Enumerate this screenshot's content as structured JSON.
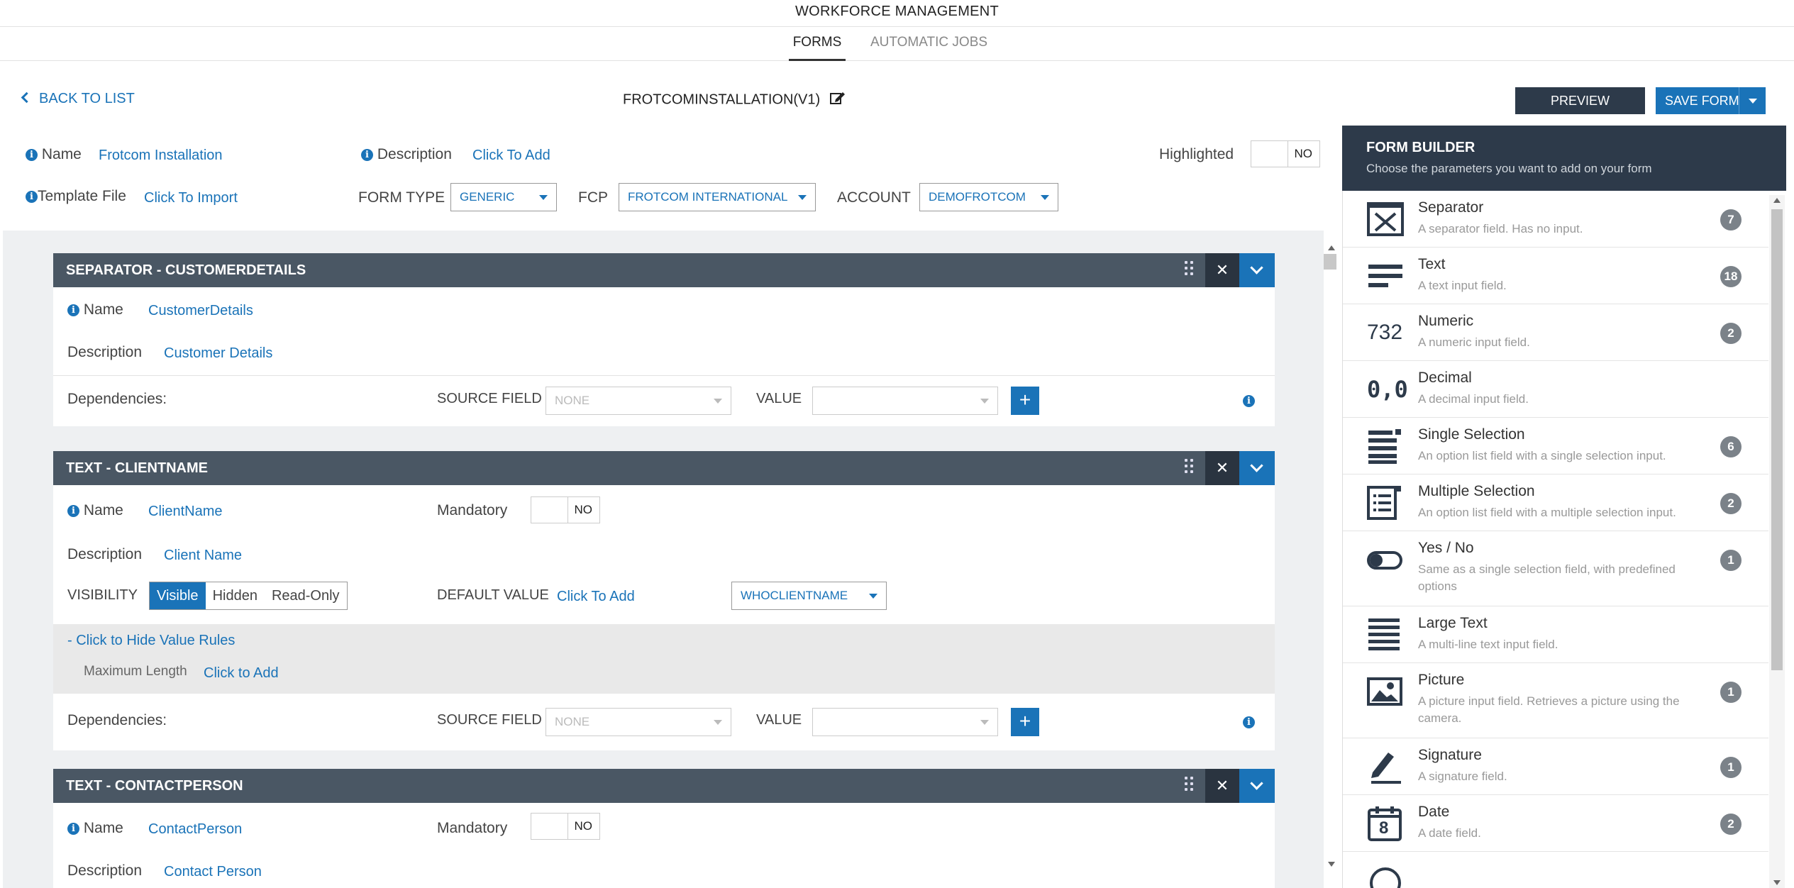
{
  "app": {
    "title": "WORKFORCE MANAGEMENT"
  },
  "tabs": [
    {
      "label": "FORMS"
    },
    {
      "label": "AUTOMATIC JOBS"
    }
  ],
  "header": {
    "back_label": "BACK TO LIST",
    "form_title": "FROTCOMINSTALLATION(V1)",
    "preview_label": "PREVIEW",
    "save_label": "SAVE FORM"
  },
  "props": {
    "name_label": "Name",
    "name_value": "Frotcom Installation",
    "description_label": "Description",
    "description_value": "Click To Add",
    "highlighted_label": "Highlighted",
    "highlighted_value": "NO",
    "template_label": "Template File",
    "template_value": "Click To Import",
    "form_type_label": "FORM TYPE",
    "form_type_value": "GENERIC",
    "fcp_label": "FCP",
    "fcp_value": "FROTCOM INTERNATIONAL",
    "account_label": "ACCOUNT",
    "account_value": "DEMOFROTCOM"
  },
  "sections": [
    {
      "title": "SEPARATOR - CUSTOMERDETAILS",
      "name_label": "Name",
      "name_value": "CustomerDetails",
      "description_label": "Description",
      "description_value": "Customer Details",
      "dependencies_label": "Dependencies:",
      "source_label": "SOURCE FIELD",
      "source_value": "NONE",
      "value_label": "VALUE",
      "value_value": ""
    },
    {
      "title": "TEXT - CLIENTNAME",
      "name_label": "Name",
      "name_value": "ClientName",
      "mandatory_label": "Mandatory",
      "mandatory_value": "NO",
      "description_label": "Description",
      "description_value": "Client Name",
      "visibility_label": "VISIBILITY",
      "visibility_options": [
        "Visible",
        "Hidden",
        "Read-Only"
      ],
      "default_label": "DEFAULT VALUE",
      "default_value": "Click To Add",
      "default_select": "WHOCLIENTNAME",
      "rules_toggle": "- Click to Hide Value Rules",
      "max_length_label": "Maximum Length",
      "max_length_value": "Click to Add",
      "dependencies_label": "Dependencies:",
      "source_label": "SOURCE FIELD",
      "source_value": "NONE",
      "value_label": "VALUE",
      "value_value": ""
    },
    {
      "title": "TEXT - CONTACTPERSON",
      "name_label": "Name",
      "name_value": "ContactPerson",
      "mandatory_label": "Mandatory",
      "mandatory_value": "NO",
      "description_label": "Description",
      "description_value": "Contact Person"
    }
  ],
  "form_builder": {
    "title": "FORM BUILDER",
    "subtitle": "Choose the parameters you want to add on your form",
    "items": [
      {
        "title": "Separator",
        "desc": "A separator field. Has no input.",
        "count": "7",
        "icon": "separator-icon"
      },
      {
        "title": "Text",
        "desc": "A text input field.",
        "count": "18",
        "icon": "text-icon"
      },
      {
        "title": "Numeric",
        "desc": "A numeric input field.",
        "count": "2",
        "icon": "numeric-icon",
        "glyph": "732"
      },
      {
        "title": "Decimal",
        "desc": "A decimal input field.",
        "count": "",
        "icon": "decimal-icon",
        "glyph": "0,0"
      },
      {
        "title": "Single Selection",
        "desc": "An option list field with a single selection input.",
        "count": "6",
        "icon": "single-selection-icon"
      },
      {
        "title": "Multiple Selection",
        "desc": "An option list field with a multiple selection input.",
        "count": "2",
        "icon": "multiple-selection-icon"
      },
      {
        "title": "Yes / No",
        "desc": "Same as a single selection field, with predefined options",
        "count": "1",
        "icon": "toggle-icon"
      },
      {
        "title": "Large Text",
        "desc": "A multi-line text input field.",
        "count": "",
        "icon": "large-text-icon"
      },
      {
        "title": "Picture",
        "desc": "A picture input field. Retrieves a picture using the camera.",
        "count": "1",
        "icon": "picture-icon"
      },
      {
        "title": "Signature",
        "desc": "A signature field.",
        "count": "1",
        "icon": "signature-icon"
      },
      {
        "title": "Date",
        "desc": "A date field.",
        "count": "2",
        "icon": "date-icon",
        "glyph": "8"
      }
    ]
  }
}
